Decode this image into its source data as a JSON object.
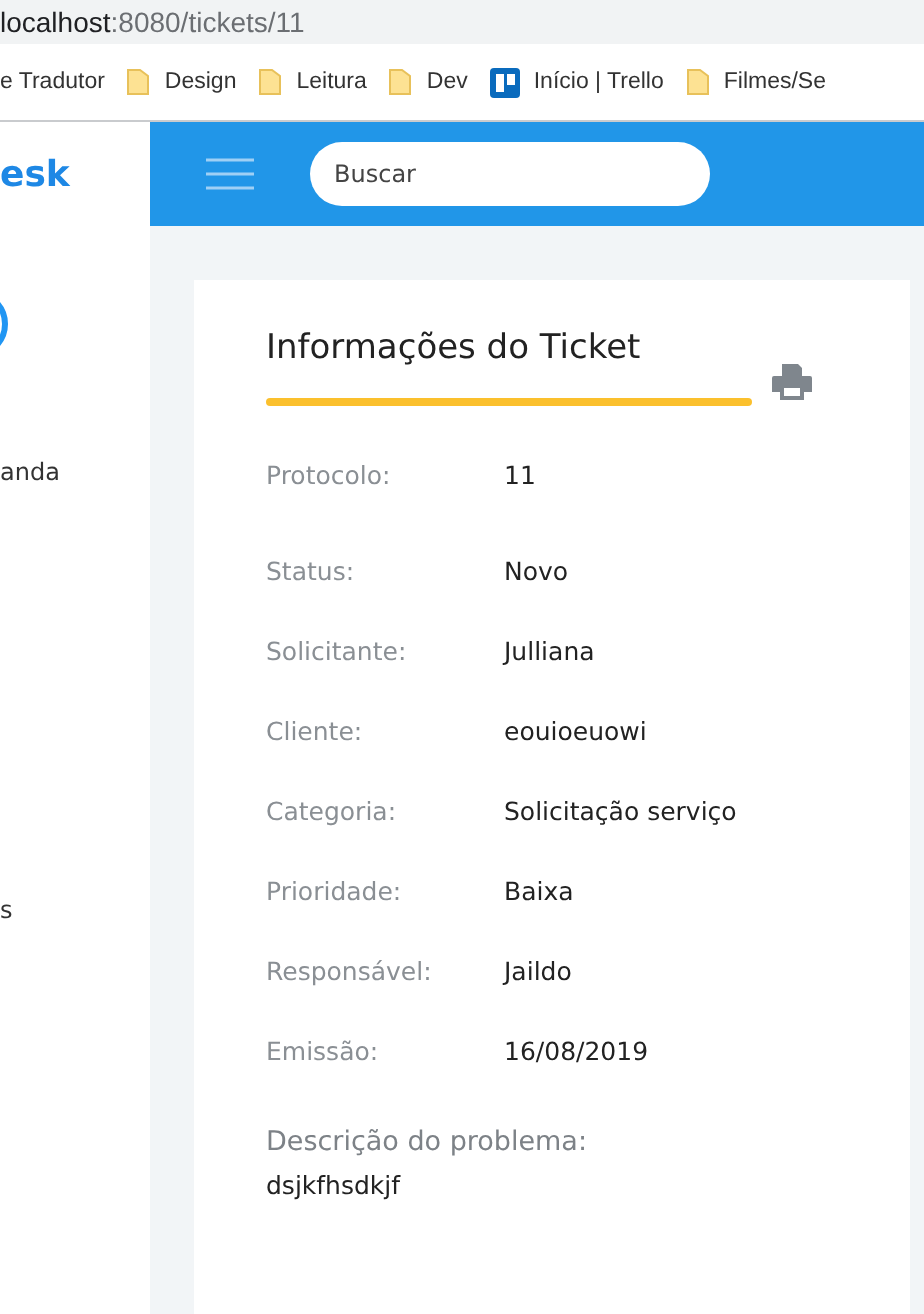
{
  "browser": {
    "url_host": "localhost",
    "url_path": ":8080/tickets/11",
    "bookmarks": [
      {
        "label": "e Tradutor",
        "kind": "plain"
      },
      {
        "label": "Design",
        "kind": "folder"
      },
      {
        "label": "Leitura",
        "kind": "folder"
      },
      {
        "label": "Dev",
        "kind": "folder"
      },
      {
        "label": "Início | Trello",
        "kind": "trello"
      },
      {
        "label": "Filmes/Se",
        "kind": "folder"
      }
    ]
  },
  "sidebar": {
    "logo": "esk",
    "items": [
      {
        "label": "anda"
      },
      {
        "label": "s"
      }
    ]
  },
  "header": {
    "search": {
      "placeholder": "Buscar"
    }
  },
  "ticket": {
    "title": "Informações do Ticket",
    "fields": [
      {
        "label": "Protocolo:",
        "value": "11"
      },
      {
        "label": "Status:",
        "value": "Novo"
      },
      {
        "label": "Solicitante:",
        "value": "Julliana"
      },
      {
        "label": "Cliente:",
        "value": "eouioeuowi"
      },
      {
        "label": "Categoria:",
        "value": "Solicitação serviço"
      },
      {
        "label": "Prioridade:",
        "value": "Baixa"
      },
      {
        "label": "Responsável:",
        "value": "Jaildo"
      },
      {
        "label": "Emissão:",
        "value": "16/08/2019"
      }
    ],
    "description": {
      "label": "Descrição do problema:",
      "text": "dsjkfhsdkjf"
    }
  }
}
